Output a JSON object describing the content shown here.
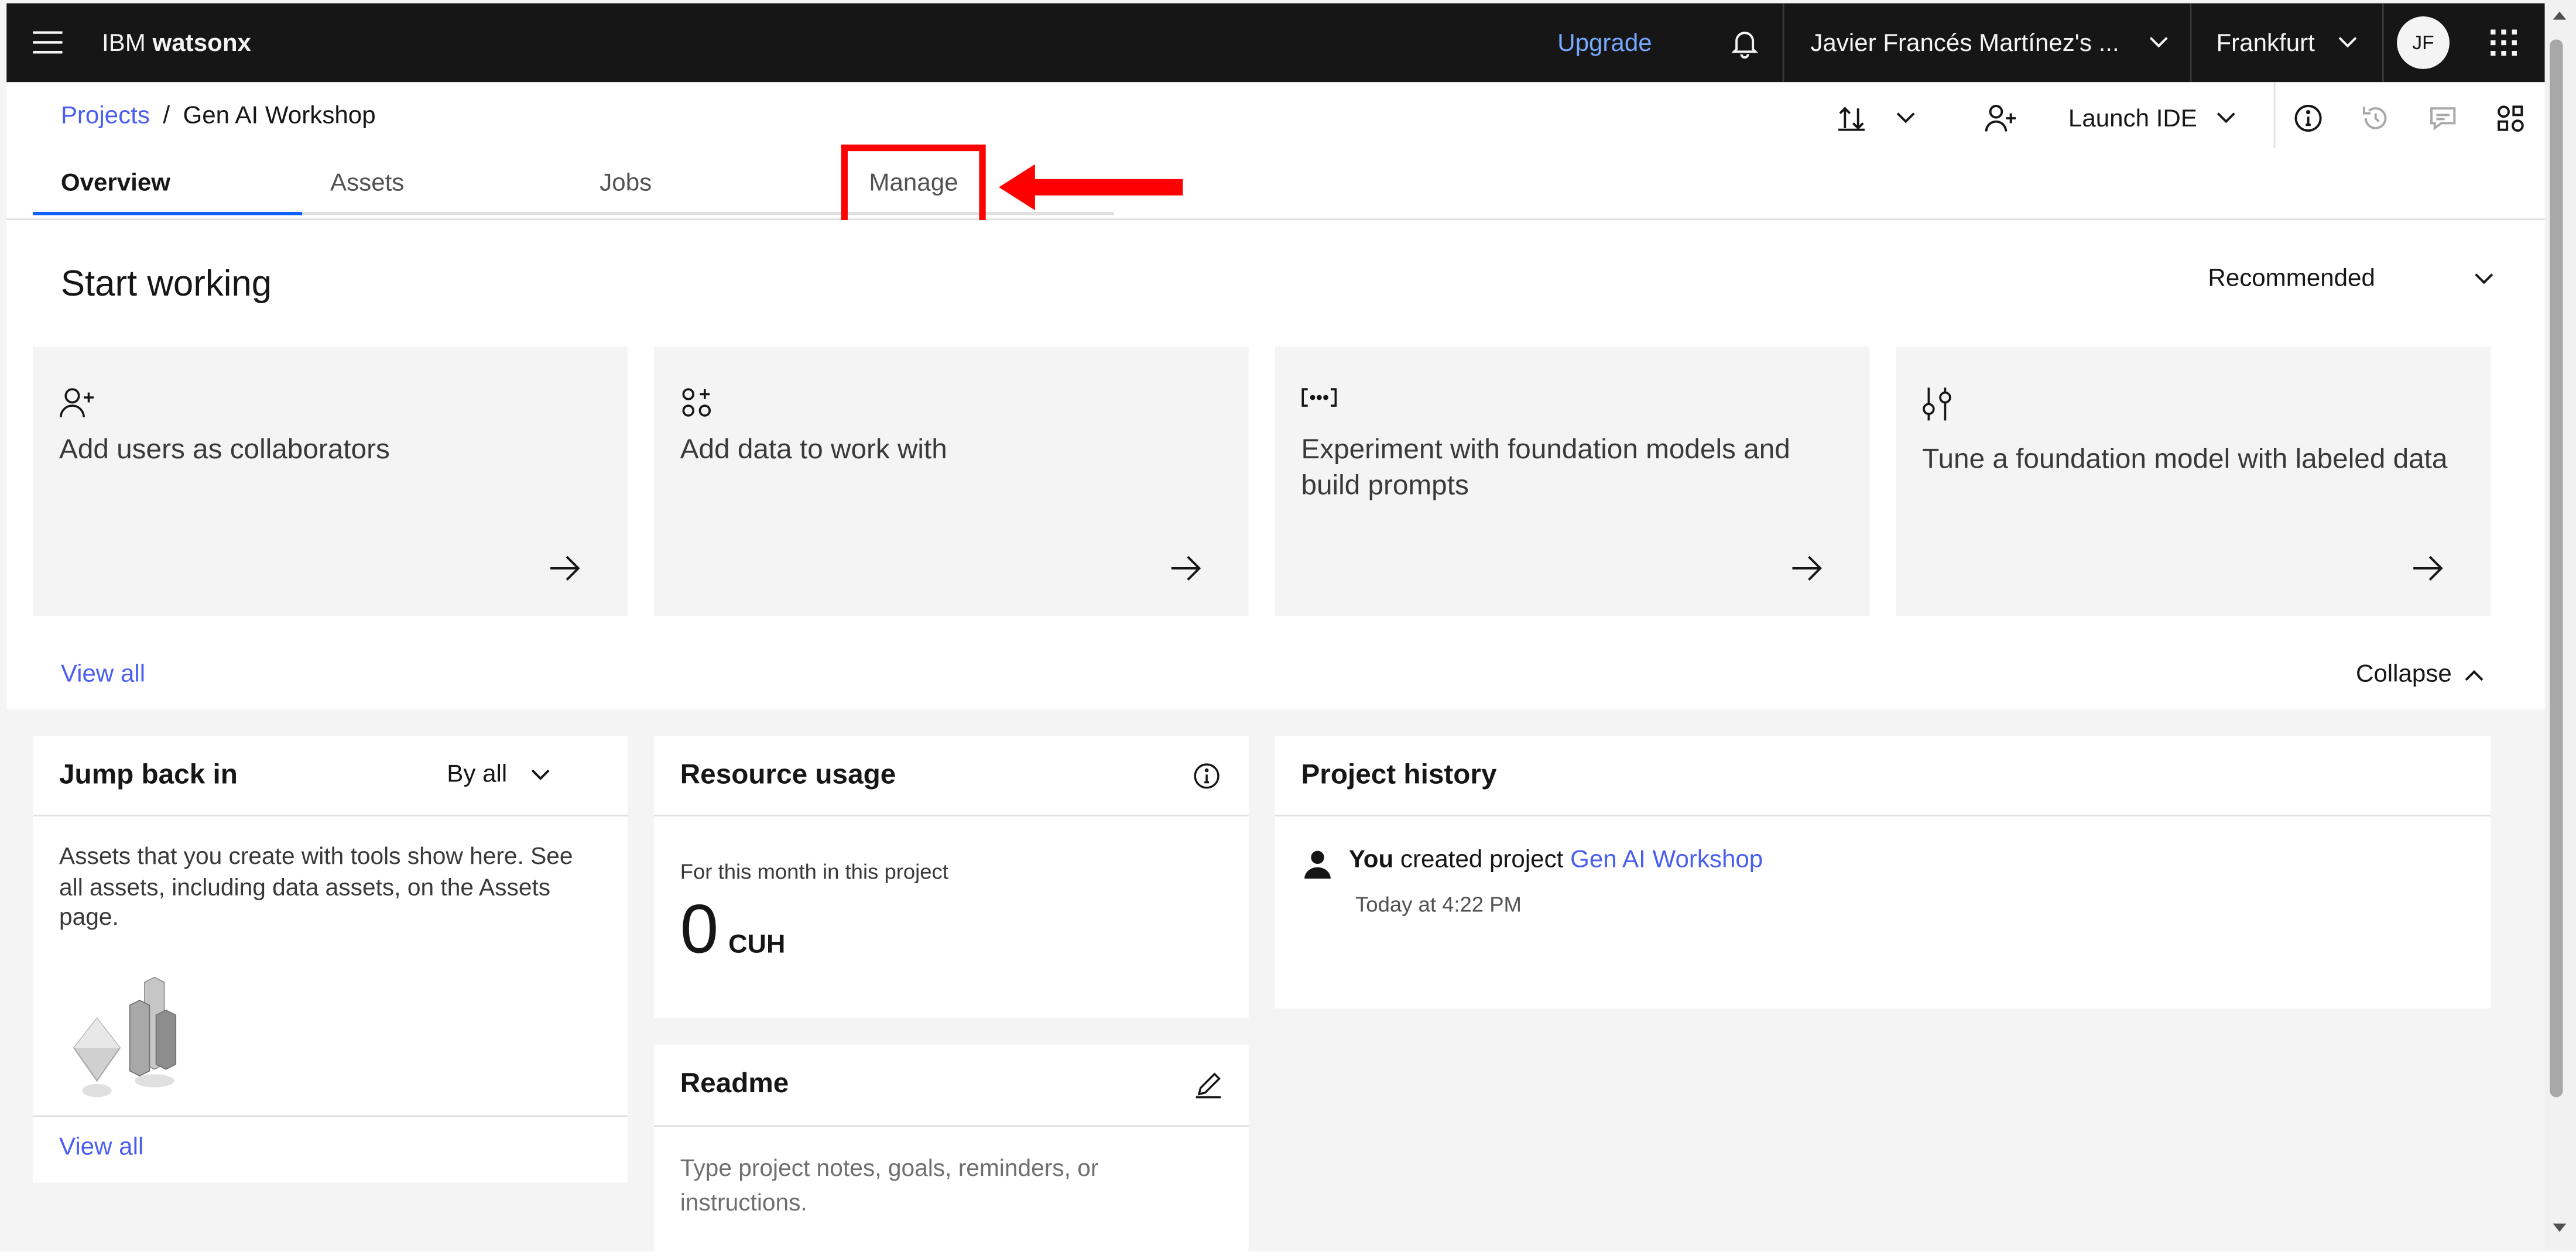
{
  "topbar": {
    "brand_prefix": "IBM",
    "brand_name": "watsonx",
    "upgrade": "Upgrade",
    "account": "Javier Francés Martínez's ...",
    "region": "Frankfurt",
    "avatar_initials": "JF"
  },
  "breadcrumb": {
    "parent": "Projects",
    "separator": "/",
    "current": "Gen AI Workshop"
  },
  "header_actions": {
    "launch_ide": "Launch IDE"
  },
  "tabs": [
    {
      "label": "Overview",
      "active": true
    },
    {
      "label": "Assets",
      "active": false
    },
    {
      "label": "Jobs",
      "active": false
    },
    {
      "label": "Manage",
      "active": false
    }
  ],
  "start": {
    "title": "Start working",
    "filter": "Recommended",
    "cards": [
      {
        "icon": "add-user-icon",
        "text": "Add users as collaborators"
      },
      {
        "icon": "data-icon",
        "text": "Add data to work with"
      },
      {
        "icon": "prompt-icon",
        "text": "Experiment with foundation models and build prompts"
      },
      {
        "icon": "tune-icon",
        "text": "Tune a foundation model with labeled data"
      }
    ],
    "view_all": "View all",
    "collapse": "Collapse"
  },
  "jump_back": {
    "title": "Jump back in",
    "filter": "By all",
    "description": "Assets that you create with tools show here. See all assets, including data assets, on the Assets page.",
    "view_all": "View all"
  },
  "resource_usage": {
    "title": "Resource usage",
    "subtitle": "For this month in this project",
    "value": "0",
    "unit": "CUH"
  },
  "readme": {
    "title": "Readme",
    "placeholder": "Type project notes, goals, reminders, or instructions."
  },
  "history": {
    "title": "Project history",
    "actor": "You",
    "action": "created project",
    "project": "Gen AI Workshop",
    "time": "Today at 4:22 PM"
  },
  "colors": {
    "accent": "#0f62fe",
    "annotation": "#ff0000",
    "topbar": "#161616"
  }
}
